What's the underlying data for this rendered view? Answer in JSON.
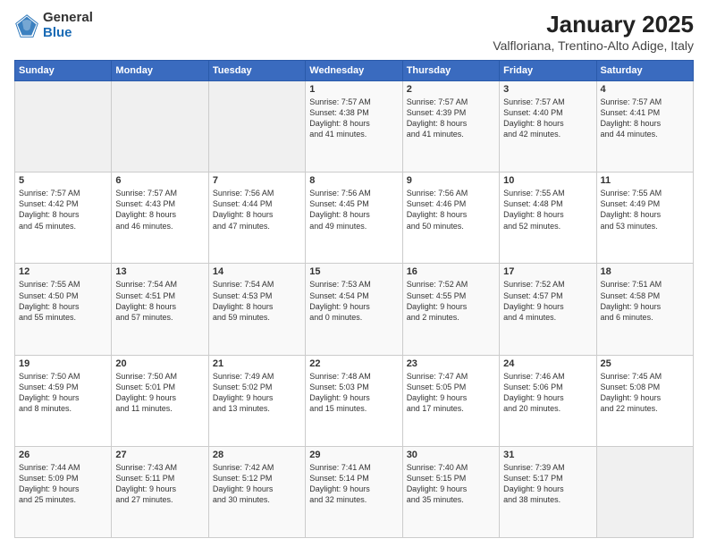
{
  "logo": {
    "text_general": "General",
    "text_blue": "Blue"
  },
  "header": {
    "title": "January 2025",
    "subtitle": "Valfloriana, Trentino-Alto Adige, Italy"
  },
  "weekdays": [
    "Sunday",
    "Monday",
    "Tuesday",
    "Wednesday",
    "Thursday",
    "Friday",
    "Saturday"
  ],
  "weeks": [
    [
      {
        "day": "",
        "empty": true
      },
      {
        "day": "",
        "empty": true
      },
      {
        "day": "",
        "empty": true
      },
      {
        "day": "1",
        "sunrise": "7:57 AM",
        "sunset": "4:38 PM",
        "daylight": "8 hours and 41 minutes."
      },
      {
        "day": "2",
        "sunrise": "7:57 AM",
        "sunset": "4:39 PM",
        "daylight": "8 hours and 41 minutes."
      },
      {
        "day": "3",
        "sunrise": "7:57 AM",
        "sunset": "4:40 PM",
        "daylight": "8 hours and 42 minutes."
      },
      {
        "day": "4",
        "sunrise": "7:57 AM",
        "sunset": "4:41 PM",
        "daylight": "8 hours and 44 minutes."
      }
    ],
    [
      {
        "day": "5",
        "sunrise": "7:57 AM",
        "sunset": "4:42 PM",
        "daylight": "8 hours and 45 minutes."
      },
      {
        "day": "6",
        "sunrise": "7:57 AM",
        "sunset": "4:43 PM",
        "daylight": "8 hours and 46 minutes."
      },
      {
        "day": "7",
        "sunrise": "7:56 AM",
        "sunset": "4:44 PM",
        "daylight": "8 hours and 47 minutes."
      },
      {
        "day": "8",
        "sunrise": "7:56 AM",
        "sunset": "4:45 PM",
        "daylight": "8 hours and 49 minutes."
      },
      {
        "day": "9",
        "sunrise": "7:56 AM",
        "sunset": "4:46 PM",
        "daylight": "8 hours and 50 minutes."
      },
      {
        "day": "10",
        "sunrise": "7:55 AM",
        "sunset": "4:48 PM",
        "daylight": "8 hours and 52 minutes."
      },
      {
        "day": "11",
        "sunrise": "7:55 AM",
        "sunset": "4:49 PM",
        "daylight": "8 hours and 53 minutes."
      }
    ],
    [
      {
        "day": "12",
        "sunrise": "7:55 AM",
        "sunset": "4:50 PM",
        "daylight": "8 hours and 55 minutes."
      },
      {
        "day": "13",
        "sunrise": "7:54 AM",
        "sunset": "4:51 PM",
        "daylight": "8 hours and 57 minutes."
      },
      {
        "day": "14",
        "sunrise": "7:54 AM",
        "sunset": "4:53 PM",
        "daylight": "8 hours and 59 minutes."
      },
      {
        "day": "15",
        "sunrise": "7:53 AM",
        "sunset": "4:54 PM",
        "daylight": "9 hours and 0 minutes."
      },
      {
        "day": "16",
        "sunrise": "7:52 AM",
        "sunset": "4:55 PM",
        "daylight": "9 hours and 2 minutes."
      },
      {
        "day": "17",
        "sunrise": "7:52 AM",
        "sunset": "4:57 PM",
        "daylight": "9 hours and 4 minutes."
      },
      {
        "day": "18",
        "sunrise": "7:51 AM",
        "sunset": "4:58 PM",
        "daylight": "9 hours and 6 minutes."
      }
    ],
    [
      {
        "day": "19",
        "sunrise": "7:50 AM",
        "sunset": "4:59 PM",
        "daylight": "9 hours and 8 minutes."
      },
      {
        "day": "20",
        "sunrise": "7:50 AM",
        "sunset": "5:01 PM",
        "daylight": "9 hours and 11 minutes."
      },
      {
        "day": "21",
        "sunrise": "7:49 AM",
        "sunset": "5:02 PM",
        "daylight": "9 hours and 13 minutes."
      },
      {
        "day": "22",
        "sunrise": "7:48 AM",
        "sunset": "5:03 PM",
        "daylight": "9 hours and 15 minutes."
      },
      {
        "day": "23",
        "sunrise": "7:47 AM",
        "sunset": "5:05 PM",
        "daylight": "9 hours and 17 minutes."
      },
      {
        "day": "24",
        "sunrise": "7:46 AM",
        "sunset": "5:06 PM",
        "daylight": "9 hours and 20 minutes."
      },
      {
        "day": "25",
        "sunrise": "7:45 AM",
        "sunset": "5:08 PM",
        "daylight": "9 hours and 22 minutes."
      }
    ],
    [
      {
        "day": "26",
        "sunrise": "7:44 AM",
        "sunset": "5:09 PM",
        "daylight": "9 hours and 25 minutes."
      },
      {
        "day": "27",
        "sunrise": "7:43 AM",
        "sunset": "5:11 PM",
        "daylight": "9 hours and 27 minutes."
      },
      {
        "day": "28",
        "sunrise": "7:42 AM",
        "sunset": "5:12 PM",
        "daylight": "9 hours and 30 minutes."
      },
      {
        "day": "29",
        "sunrise": "7:41 AM",
        "sunset": "5:14 PM",
        "daylight": "9 hours and 32 minutes."
      },
      {
        "day": "30",
        "sunrise": "7:40 AM",
        "sunset": "5:15 PM",
        "daylight": "9 hours and 35 minutes."
      },
      {
        "day": "31",
        "sunrise": "7:39 AM",
        "sunset": "5:17 PM",
        "daylight": "9 hours and 38 minutes."
      },
      {
        "day": "",
        "empty": true
      }
    ]
  ]
}
